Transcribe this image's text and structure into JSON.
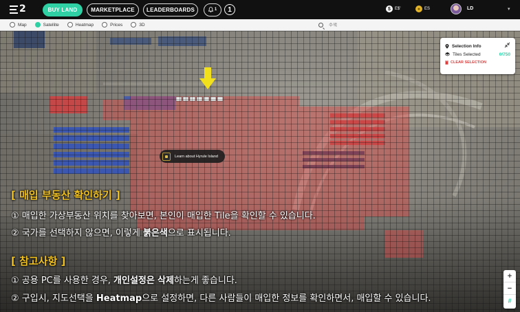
{
  "nav": {
    "logo": "2",
    "buy_land": "BUY LAND",
    "marketplace": "MARKETPLACE",
    "leaderboards": "LEADERBOARDS",
    "notification_count": "1",
    "step_marker": "1",
    "balance_primary": "E$'",
    "balance_secondary": "ES",
    "username": "LD"
  },
  "view_modes": {
    "map": "Map",
    "satellite": "Satellite",
    "heatmap": "Heatmap",
    "prices": "Prices",
    "three_d": "3D",
    "selected": "Satellite"
  },
  "search": {
    "placeholder": "수색"
  },
  "selection_panel": {
    "title": "Selection Info",
    "tiles_label": "Tiles Selected",
    "tiles_count": "0/750",
    "clear_label": "CLEAR SELECTION"
  },
  "tooltip": {
    "text": "Learn about Hyrule Island"
  },
  "zoom": {
    "in": "+",
    "out": "−",
    "locate": "#"
  },
  "colors": {
    "accent": "#2fd1a4",
    "selection": "#e04848",
    "annotation_heading": "#f0c020"
  },
  "annotations": {
    "heading1": "[ 매입 부동산 확인하기 ]",
    "line1": "① 매입한 가상부동산 위치를 찾아보면, 본인이 매입한 Tile을 확인할 수 있습니다.",
    "line2_pre": "② 국가를 선택하지 않으면, 이렇게 ",
    "line2_bold": "붉은색",
    "line2_post": "으로 표시됩니다.",
    "heading2": "[ 참고사항 ]",
    "line3_pre": "① 공용 PC를 사용한 경우, ",
    "line3_bold1": "개인설정은",
    "line3_mid": " ",
    "line3_bold2": "삭제",
    "line3_post": "하는게 좋습니다.",
    "line4_pre": "② 구입시, 지도선택을 ",
    "line4_bold": "Heatmap",
    "line4_post": "으로 설정하면, 다른 사람들이 매입한 정보를 확인하면서, 매입할 수 있습니다."
  }
}
